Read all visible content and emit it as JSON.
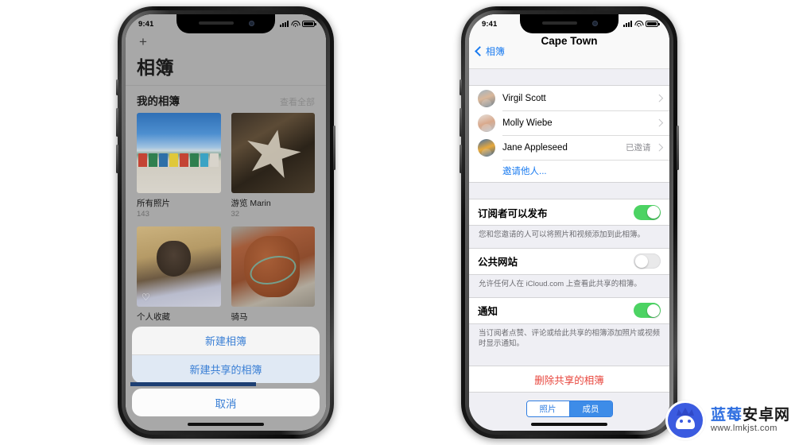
{
  "watermark": {
    "brand_blue": "蓝莓",
    "brand_dark": "安卓网",
    "url": "www.lmkjst.com",
    "accent": "#3b5be0"
  },
  "phone_left": {
    "status_bar": {
      "time": "9:41",
      "signal_icon": "cellular-signal-icon",
      "wifi_icon": "wifi-icon",
      "battery_icon": "battery-icon"
    },
    "nav": {
      "add_icon": "plus-icon",
      "title": "相簿"
    },
    "section": {
      "title": "我的相簿",
      "see_all": "查看全部"
    },
    "albums": [
      {
        "name": "所有照片",
        "count": "143",
        "photo": "beach-huts-photo",
        "favorite": false
      },
      {
        "name": "游览 Marin",
        "count": "32",
        "photo": "starfish-in-hands-photo",
        "favorite": false
      },
      {
        "name": "个人收藏",
        "count": "",
        "photo": "dog-under-blanket-photo",
        "favorite": true
      },
      {
        "name": "骑马",
        "count": "",
        "photo": "brown-horse-photo",
        "favorite": false
      }
    ],
    "action_sheet": {
      "items": [
        {
          "label": "新建相簿",
          "highlighted": false
        },
        {
          "label": "新建共享的相簿",
          "highlighted": true
        }
      ],
      "cancel": "取消"
    }
  },
  "phone_right": {
    "status_bar": {
      "time": "9:41",
      "signal_icon": "cellular-signal-icon",
      "wifi_icon": "wifi-icon",
      "battery_icon": "battery-icon"
    },
    "nav": {
      "back_label": "相簿",
      "back_icon": "chevron-left-icon",
      "title": "Cape Town"
    },
    "members": [
      {
        "name": "Virgil Scott",
        "status": "",
        "avatar": "avatar-virgil-scott"
      },
      {
        "name": "Molly Wiebe",
        "status": "",
        "avatar": "avatar-molly-wiebe"
      },
      {
        "name": "Jane Appleseed",
        "status": "已邀请",
        "avatar": "avatar-jane-appleseed"
      }
    ],
    "invite_link": "邀请他人...",
    "settings": [
      {
        "label": "订阅者可以发布",
        "value": "on",
        "footnote": "您和您邀请的人可以将照片和视频添加到此相簿。"
      },
      {
        "label": "公共网站",
        "value": "off",
        "footnote": "允许任何人在 iCloud.com 上查看此共享的相簿。"
      },
      {
        "label": "通知",
        "value": "on",
        "footnote": "当订阅者点赞、评论或给此共享的相簿添加照片或视频时显示通知。"
      }
    ],
    "delete_label": "删除共享的相簿",
    "segmented": {
      "options": [
        {
          "label": "照片",
          "selected": false
        },
        {
          "label": "成员",
          "selected": true
        }
      ]
    },
    "colors": {
      "toggle_on": "#4cd363",
      "tint": "#1a7bf0",
      "danger": "#e8453c"
    }
  }
}
